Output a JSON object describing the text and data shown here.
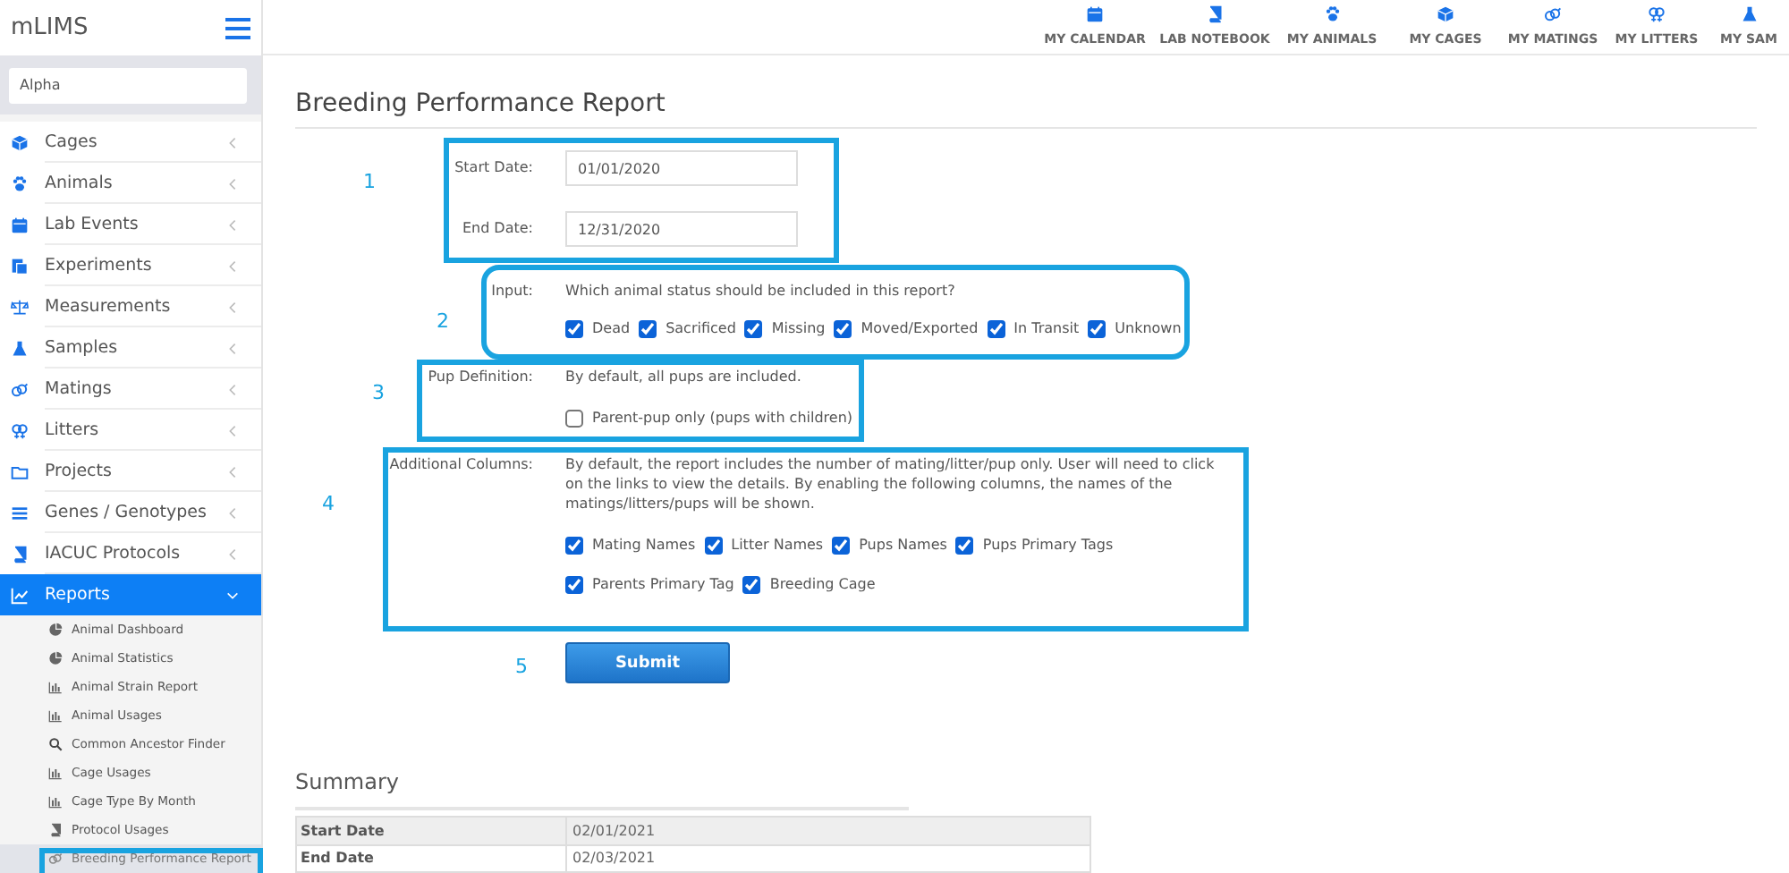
{
  "sidebar": {
    "brand": "mLIMS",
    "search": {
      "value": "Alpha"
    },
    "items": [
      {
        "label": "Cages",
        "expanded": false,
        "selected": false
      },
      {
        "label": "Animals",
        "expanded": false,
        "selected": false
      },
      {
        "label": "Lab Events",
        "expanded": false,
        "selected": false
      },
      {
        "label": "Experiments",
        "expanded": false,
        "selected": false
      },
      {
        "label": "Measurements",
        "expanded": false,
        "selected": false
      },
      {
        "label": "Samples",
        "expanded": false,
        "selected": false
      },
      {
        "label": "Matings",
        "expanded": false,
        "selected": false
      },
      {
        "label": "Litters",
        "expanded": false,
        "selected": false
      },
      {
        "label": "Projects",
        "expanded": false,
        "selected": false
      },
      {
        "label": "Genes / Genotypes",
        "expanded": false,
        "selected": false
      },
      {
        "label": "IACUC Protocols",
        "expanded": false,
        "selected": false
      },
      {
        "label": "Reports",
        "expanded": true,
        "selected": true,
        "children": [
          {
            "label": "Animal Dashboard",
            "selected": false
          },
          {
            "label": "Animal Statistics",
            "selected": false
          },
          {
            "label": "Animal Strain Report",
            "selected": false
          },
          {
            "label": "Animal Usages",
            "selected": false
          },
          {
            "label": "Common Ancestor Finder",
            "selected": false
          },
          {
            "label": "Cage Usages",
            "selected": false
          },
          {
            "label": "Cage Type By Month",
            "selected": false
          },
          {
            "label": "Protocol Usages",
            "selected": false
          },
          {
            "label": "Breeding Performance Report",
            "selected": true
          }
        ]
      }
    ]
  },
  "top_nav": [
    {
      "label": "MY CALENDAR"
    },
    {
      "label": "LAB NOTEBOOK"
    },
    {
      "label": "MY ANIMALS"
    },
    {
      "label": "MY CAGES"
    },
    {
      "label": "MY MATINGS"
    },
    {
      "label": "MY LITTERS"
    },
    {
      "label": "MY SAM"
    }
  ],
  "page": {
    "title": "Breeding Performance Report",
    "dates": [
      {
        "label": "Start Date:",
        "value": "01/01/2020"
      },
      {
        "label": "End Date:",
        "value": "12/31/2020"
      }
    ],
    "status": {
      "label": "Input:",
      "prompt": "Which animal status should be included in this report?",
      "options": [
        {
          "label": "Dead",
          "checked": true
        },
        {
          "label": "Sacrificed",
          "checked": true
        },
        {
          "label": "Missing",
          "checked": true
        },
        {
          "label": "Moved/Exported",
          "checked": true
        },
        {
          "label": "In Transit",
          "checked": true
        },
        {
          "label": "Unknown",
          "checked": true
        }
      ]
    },
    "pup_definition": {
      "label": "Pup Definition:",
      "note": "By default, all pups are included.",
      "options": [
        {
          "label": "Parent-pup only (pups with children)",
          "checked": false
        }
      ]
    },
    "additional_columns": {
      "label": "Additional Columns:",
      "note": "By default, the report includes the number of mating/litter/pup only. User will need to click on the links to view the details. By enabling the following columns, the names of the matings/litters/pups will be shown.",
      "option_rows": [
        [
          {
            "label": "Mating Names",
            "checked": true
          },
          {
            "label": "Litter Names",
            "checked": true
          },
          {
            "label": "Pups Names",
            "checked": true
          },
          {
            "label": "Pups Primary Tags",
            "checked": true
          }
        ],
        [
          {
            "label": "Parents Primary Tag",
            "checked": true
          },
          {
            "label": "Breeding Cage",
            "checked": true
          }
        ]
      ]
    },
    "submit": "Submit"
  },
  "annotations": [
    {
      "label": "1"
    },
    {
      "label": "2"
    },
    {
      "label": "3"
    },
    {
      "label": "4"
    },
    {
      "label": "5"
    }
  ],
  "summary": {
    "title": "Summary",
    "rows": [
      {
        "label": "Start Date",
        "value": "02/01/2021"
      },
      {
        "label": "End Date",
        "value": "02/03/2021"
      }
    ]
  }
}
